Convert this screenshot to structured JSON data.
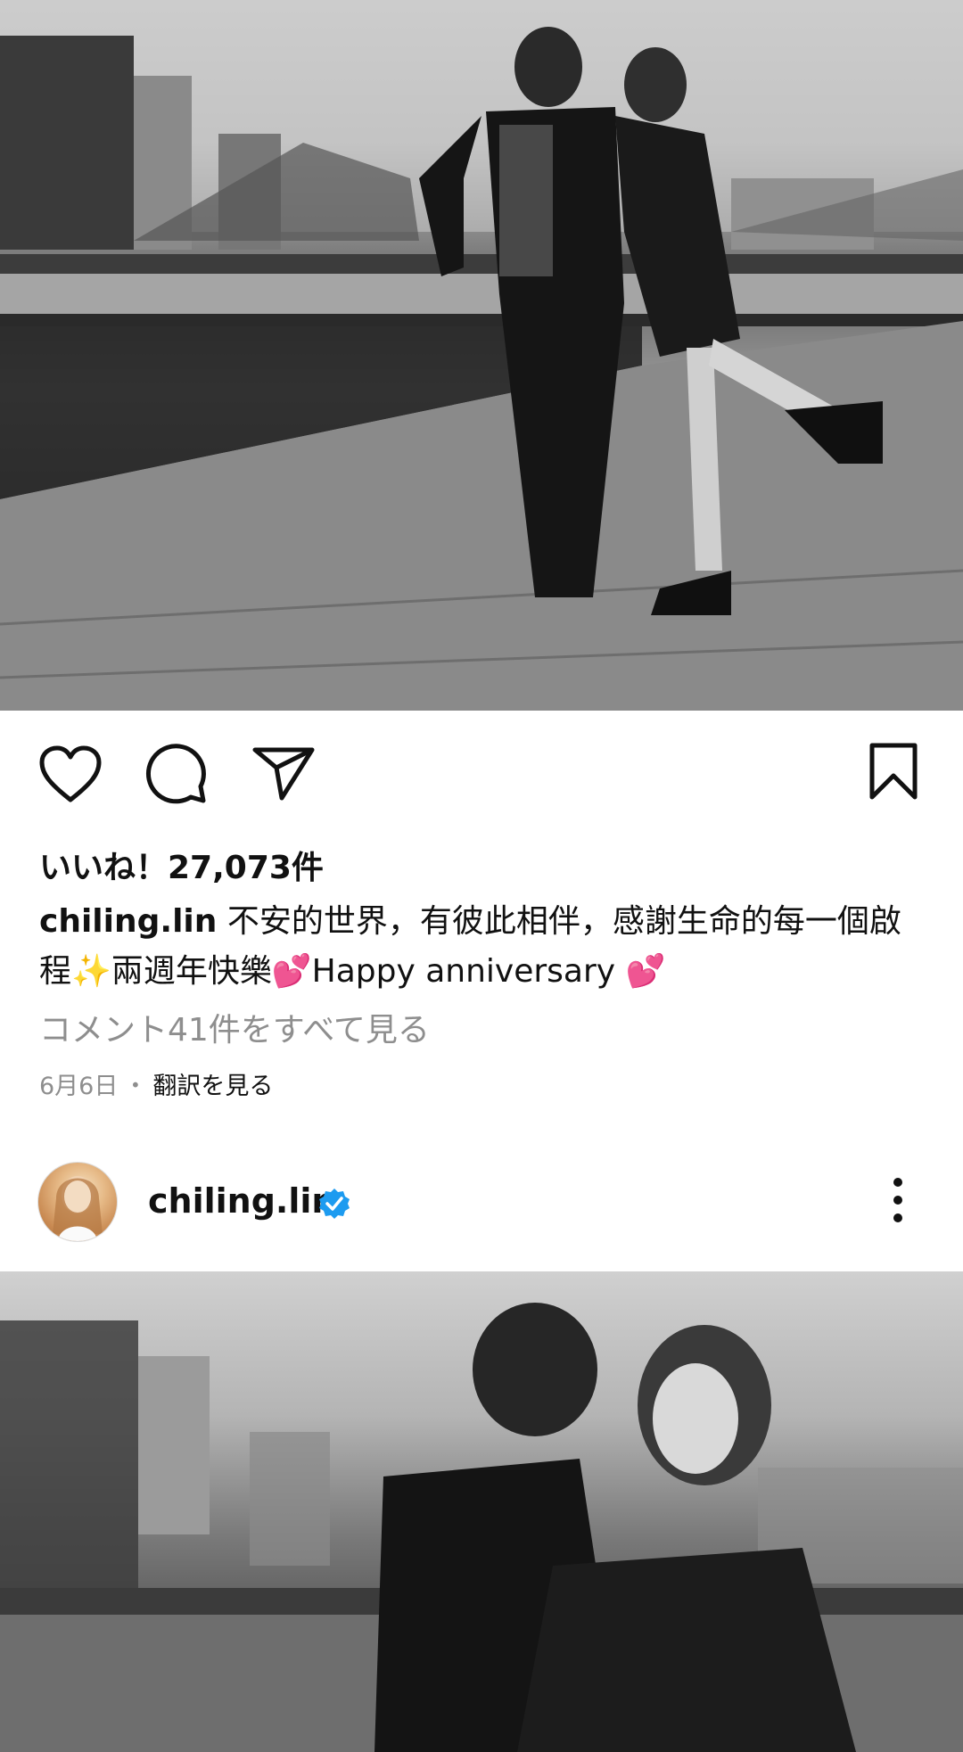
{
  "post1": {
    "image_alt": "",
    "likes_text": "いいね！27,073件",
    "caption_user": "chiling.lin",
    "caption_text": "不安的世界，有彼此相伴，感謝生命的每一個啟程✨兩週年快樂💕Happy anniversary 💕",
    "view_comments": "コメント41件をすべて見る",
    "date": "6月6日",
    "separator": "・",
    "translate": "翻訳を見る"
  },
  "post2": {
    "username": "chiling.lin",
    "verified": true
  },
  "icons": {
    "like": "heart-icon",
    "comment": "comment-bubble-icon",
    "share": "paper-plane-icon",
    "save": "bookmark-icon",
    "verified": "verified-badge-icon",
    "more": "more-vertical-icon"
  },
  "colors": {
    "text": "#111111",
    "secondary": "#8e8e8e",
    "verified": "#1d9bf0",
    "background": "#ffffff"
  }
}
